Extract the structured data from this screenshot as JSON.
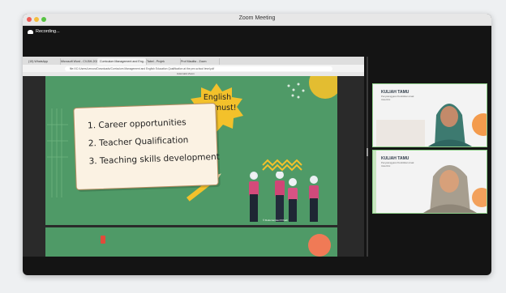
{
  "window": {
    "title": "Zoom Meeting",
    "recording": "Recording..."
  },
  "browser": {
    "tabs": [
      "(15) WhatsApp",
      "Microsoft Word - CV-BH-2023-2...",
      "Curriculum Management and Eng...",
      "Tabel - Projek",
      "Prof Maulita - Zoom"
    ],
    "url": "file:///C:/Users/Lenovo/Downloads/Curriculum Management and English Education Qualification at the pre-school level.pdf",
    "zoom": "Automatic Zoom"
  },
  "slide": {
    "items": [
      "1. Career opportunities",
      "2. Teacher Qualification",
      "3. Teaching skills development"
    ],
    "badge_line1": "English",
    "badge_line2": "is a must!",
    "credit": "© Dokumentasi Pribadi"
  },
  "gallery": {
    "tiles": [
      {
        "title": "KULIAH TAMU",
        "subtitle": "Penyelenggara Pendidikan Anak Usia Dini"
      },
      {
        "title": "KULIAH TAMU",
        "subtitle": "Penyelenggara Pendidikan Anak Usia Dini"
      }
    ]
  },
  "colors": {
    "slide_green": "#4f9a67",
    "tile_border": "#8fd08a",
    "badge_yellow": "#f3c12b"
  }
}
